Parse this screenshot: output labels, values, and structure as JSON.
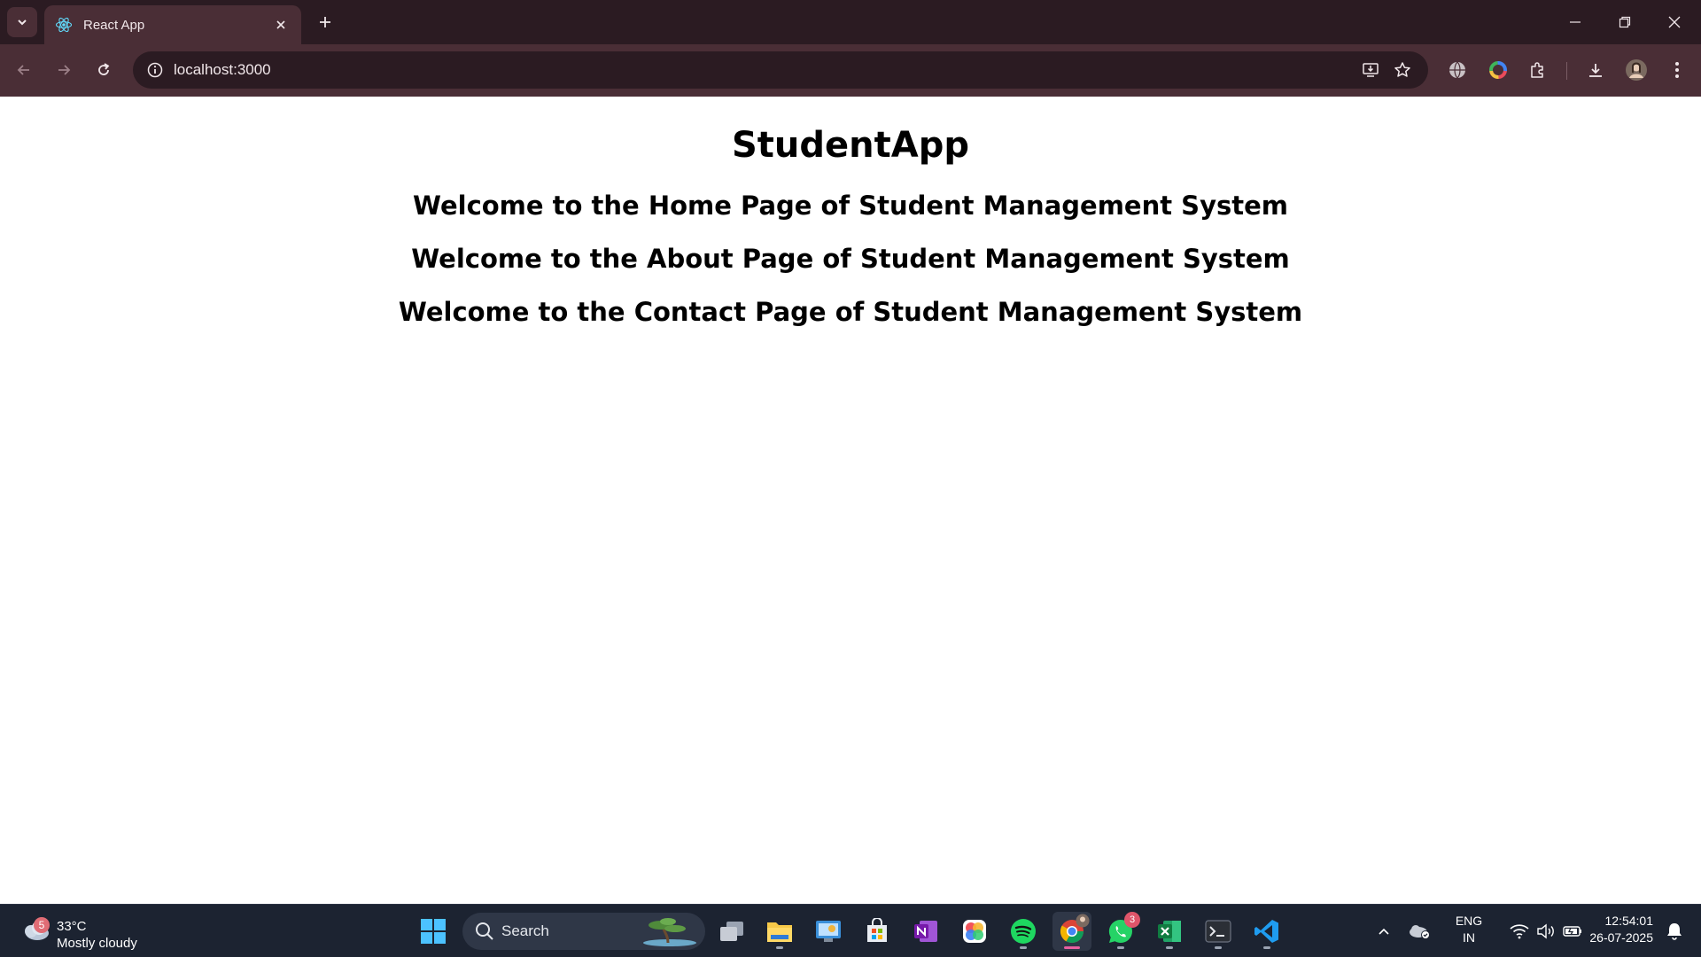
{
  "browser": {
    "tab": {
      "title": "React App",
      "favicon": "react-icon"
    },
    "address_bar": {
      "url": "localhost:3000"
    },
    "colors": {
      "frame": "#2b1b22",
      "toolbar": "#4a2e36"
    }
  },
  "page": {
    "title": "StudentApp",
    "headings": [
      "Welcome to the Home Page of Student Management System",
      "Welcome to the About Page of Student Management System",
      "Welcome to the Contact Page of Student Management System"
    ]
  },
  "taskbar": {
    "weather": {
      "badge": "5",
      "temp": "33°C",
      "condition": "Mostly cloudy"
    },
    "search": {
      "label": "Search"
    },
    "whatsapp_badge": "3",
    "language": {
      "line1": "ENG",
      "line2": "IN"
    },
    "clock": {
      "time": "12:54:01",
      "date": "26-07-2025"
    },
    "apps": [
      "start-icon",
      "search-icon",
      "task-view-icon",
      "file-explorer-icon",
      "control-panel-icon",
      "microsoft-store-icon",
      "onenote-icon",
      "photos-icon",
      "spotify-icon",
      "chrome-icon",
      "whatsapp-icon",
      "excel-icon",
      "terminal-icon",
      "vscode-icon"
    ]
  }
}
